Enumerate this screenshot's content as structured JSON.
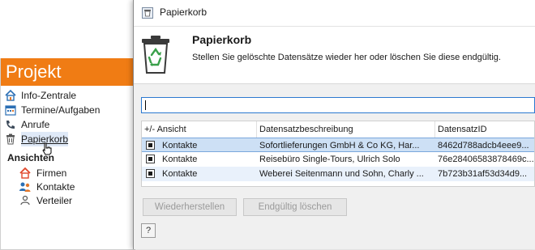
{
  "left_panel": {
    "title": "Projekt",
    "items": [
      {
        "label": "Info-Zentrale",
        "icon": "home-icon"
      },
      {
        "label": "Termine/Aufgaben",
        "icon": "calendar-icon"
      },
      {
        "label": "Anrufe",
        "icon": "phone-icon"
      },
      {
        "label": "Papierkorb",
        "icon": "trash-icon",
        "selected": true
      }
    ],
    "section_label": "Ansichten",
    "sub_items": [
      {
        "label": "Firmen",
        "icon": "home-icon"
      },
      {
        "label": "Kontakte",
        "icon": "people-icon"
      },
      {
        "label": "Verteiler",
        "icon": "distributor-icon"
      }
    ]
  },
  "dialog": {
    "window_title": "Papierkorb",
    "heading": "Papierkorb",
    "subtitle": "Stellen Sie gelöschte Datensätze wieder her oder löschen Sie diese endgültig.",
    "search": {
      "value": "",
      "placeholder": ""
    },
    "grid": {
      "columns": [
        "+/- Ansicht",
        "Datensatzbeschreibung",
        "DatensatzID"
      ],
      "rows": [
        {
          "view": "Kontakte",
          "description": "Sofortlieferungen GmbH & Co KG, Har...",
          "id": "8462d788adcb4eee9...",
          "selected": true
        },
        {
          "view": "Kontakte",
          "description": "Reisebüro Single-Tours, Ulrich Solo",
          "id": "76e28406583878469c..."
        },
        {
          "view": "Kontakte",
          "description": "Weberei Seitenmann und Sohn, Charly ...",
          "id": "7b723b31af53d34d9..."
        }
      ]
    },
    "buttons": {
      "restore": "Wiederherstellen",
      "delete": "Endgültig löschen",
      "help": "?"
    }
  },
  "colors": {
    "header_orange": "#f07c14",
    "selection_blue": "#cde0f5",
    "focus_blue": "#2b79d0",
    "recycle_green": "#3aa04a"
  }
}
